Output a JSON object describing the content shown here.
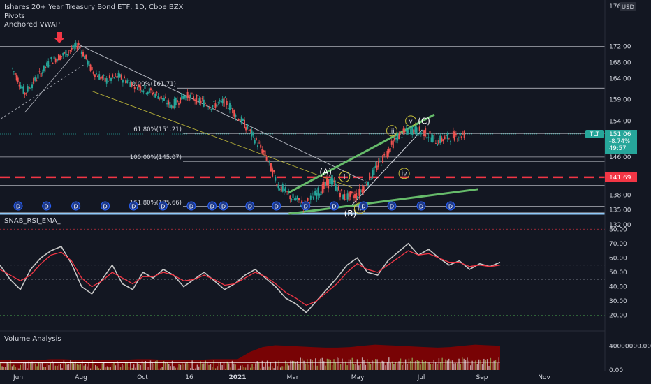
{
  "header": {
    "symbol_line": "Ishares 20+ Year Treasury Bond ETF, 1D, Cboe BZX",
    "indicator_1": "Pivots",
    "indicator_2": "Anchored VWAP",
    "currency": "USD",
    "top_price_label": "176"
  },
  "price_badge": {
    "ticker": "TLT",
    "price": "151.06",
    "change": "-8.74%",
    "countdown": "49:57"
  },
  "red_level_badge": "141.69",
  "colors": {
    "background": "#131722",
    "price_line": "#26a69a",
    "green_badge": "#26a69a",
    "red_badge": "#f23645",
    "rsi": "#c8c8c8",
    "rsi_ema": "#f23645",
    "trend": "#66bb6a",
    "volume_area": "#8b0000"
  },
  "chart_data": [
    {
      "type": "candlestick",
      "title": "Ishares 20+ Year Treasury Bond ETF, 1D, Cboe BZX",
      "ylim": [
        130.5,
        176
      ],
      "yticks": [
        "172.00",
        "168.00",
        "164.00",
        "159.00",
        "154.00",
        "151.06",
        "146.00",
        "141.69",
        "138.00",
        "135.00",
        "132.00"
      ],
      "xticks": [
        "Jun",
        "Aug",
        "Oct",
        "16",
        "2021",
        "Mar",
        "May",
        "Jul",
        "Sep",
        "Nov"
      ],
      "fib_levels": [
        {
          "label": "0.00%(161.71)",
          "value": 161.71
        },
        {
          "label": "61.80%(151.21)",
          "value": 151.21
        },
        {
          "label": "100.00%(145.07)",
          "value": 145.07
        },
        {
          "label": "161.80%(135.66)",
          "value": 135.66
        }
      ],
      "horizontal_levels": [
        172.0,
        146.0,
        140.0,
        134.5
      ],
      "red_dashed_level": 141.69,
      "wave_labels": [
        "(A)",
        "(B)",
        "(C)",
        "i",
        "ii",
        "iii",
        "iv",
        "v"
      ],
      "dividend_marker": "D",
      "price_path": [
        [
          "2020-05-26",
          166.5
        ],
        [
          "2020-06-08",
          160.5
        ],
        [
          "2020-06-22",
          164.5
        ],
        [
          "2020-07-06",
          168.5
        ],
        [
          "2020-07-20",
          170.0
        ],
        [
          "2020-08-04",
          172.5
        ],
        [
          "2020-08-18",
          166.0
        ],
        [
          "2020-09-01",
          163.5
        ],
        [
          "2020-09-15",
          164.5
        ],
        [
          "2020-09-29",
          163.0
        ],
        [
          "2020-10-13",
          161.5
        ],
        [
          "2020-10-27",
          160.0
        ],
        [
          "2020-11-10",
          157.5
        ],
        [
          "2020-11-24",
          160.0
        ],
        [
          "2020-12-08",
          159.0
        ],
        [
          "2020-12-22",
          157.5
        ],
        [
          "2021-01-06",
          158.5
        ],
        [
          "2021-01-20",
          155.0
        ],
        [
          "2021-02-03",
          151.0
        ],
        [
          "2021-02-17",
          146.5
        ],
        [
          "2021-03-03",
          140.0
        ],
        [
          "2021-03-17",
          137.5
        ],
        [
          "2021-03-31",
          136.0
        ],
        [
          "2021-04-14",
          138.5
        ],
        [
          "2021-04-28",
          141.0
        ],
        [
          "2021-05-12",
          137.5
        ],
        [
          "2021-05-26",
          138.0
        ],
        [
          "2021-06-09",
          142.0
        ],
        [
          "2021-06-23",
          146.0
        ],
        [
          "2021-07-07",
          150.5
        ],
        [
          "2021-07-21",
          152.0
        ],
        [
          "2021-08-04",
          151.5
        ],
        [
          "2021-08-18",
          149.5
        ],
        [
          "2021-09-01",
          150.5
        ],
        [
          "2021-09-17",
          151.06
        ]
      ]
    },
    {
      "type": "line",
      "title": "SNAB_RSI_EMA_",
      "ylim": [
        15,
        85
      ],
      "yticks": [
        "80.00",
        "70.00",
        "60.00",
        "50.00",
        "40.00",
        "30.00",
        "20.00"
      ],
      "levels": [
        80,
        55,
        45,
        20
      ],
      "series": [
        {
          "name": "",
          "values": [
            55,
            45,
            38,
            52,
            60,
            65,
            68,
            56,
            40,
            35,
            45,
            55,
            42,
            38,
            50,
            46,
            52,
            48,
            40,
            45,
            50,
            44,
            38,
            42,
            48,
            52,
            46,
            40,
            32,
            28,
            22,
            30,
            38,
            46,
            55,
            60,
            50,
            48,
            58,
            64,
            70,
            62,
            66,
            60,
            55,
            58,
            52,
            56,
            54,
            57
          ]
        },
        {
          "name": "",
          "values": [
            52,
            48,
            44,
            48,
            56,
            62,
            64,
            58,
            46,
            40,
            44,
            50,
            46,
            42,
            47,
            47,
            50,
            48,
            44,
            45,
            48,
            45,
            41,
            42,
            46,
            50,
            47,
            42,
            36,
            32,
            27,
            30,
            36,
            42,
            50,
            56,
            52,
            50,
            55,
            60,
            65,
            62,
            63,
            60,
            57,
            57,
            54,
            55,
            54,
            55
          ]
        }
      ]
    },
    {
      "type": "area",
      "title": "Volume Analysis",
      "ylim": [
        0,
        60000000
      ],
      "yticks": [
        "40000000.00",
        "0.00"
      ],
      "values": [
        16,
        17,
        17,
        16,
        18,
        18,
        17,
        17,
        16,
        17,
        17,
        18,
        18,
        17,
        17,
        17,
        17,
        18,
        18,
        18,
        30,
        38,
        41,
        40,
        39,
        38,
        37,
        37,
        38,
        40,
        42,
        41,
        40,
        39,
        38,
        37,
        38,
        40,
        42,
        41,
        40
      ]
    }
  ]
}
